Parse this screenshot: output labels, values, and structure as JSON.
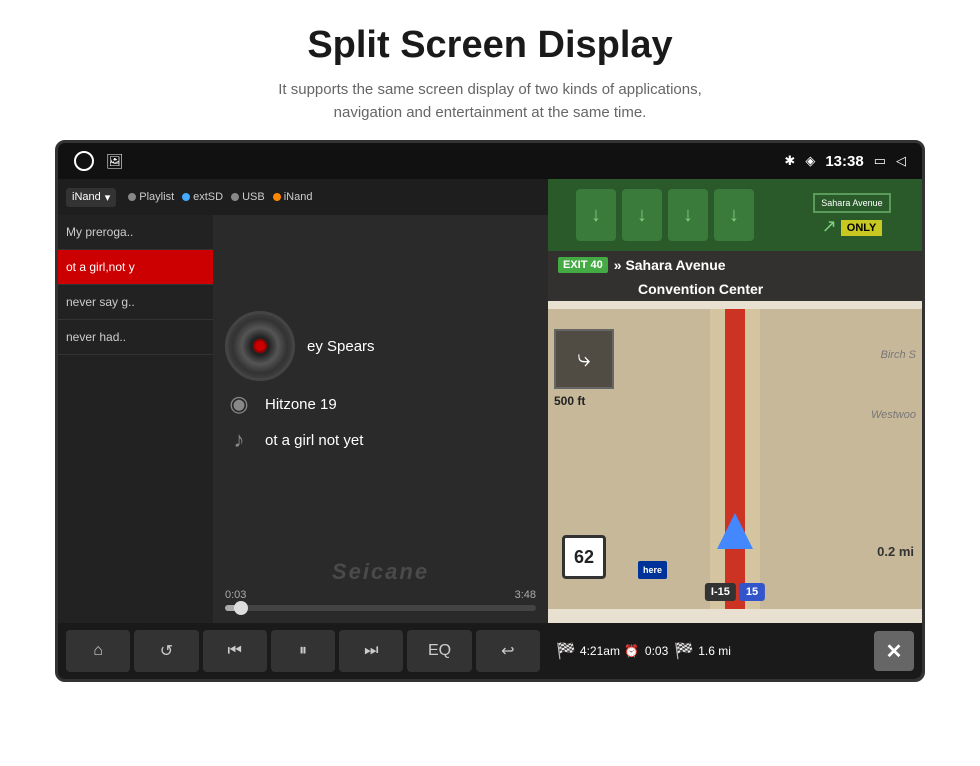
{
  "header": {
    "title": "Split Screen Display",
    "subtitle_line1": "It supports the same screen display of two kinds of applications,",
    "subtitle_line2": "navigation and entertainment at the same time."
  },
  "status_bar": {
    "time": "13:38",
    "bluetooth_icon": "✱",
    "location_icon": "◈",
    "window_icon": "▭",
    "back_icon": "◁"
  },
  "music_player": {
    "source_label": "iNand",
    "source_options": [
      "Playlist",
      "extSD",
      "USB",
      "iNand"
    ],
    "playlist": [
      {
        "title": "My preroga..",
        "active": false
      },
      {
        "title": "ot a girl,not y",
        "active": true
      },
      {
        "title": "never say g..",
        "active": false
      },
      {
        "title": "never had..",
        "active": false
      }
    ],
    "artist": "ey Spears",
    "album": "Hitzone 19",
    "track": "ot a girl not yet",
    "time_current": "0:03",
    "time_total": "3:48",
    "watermark": "Seicane",
    "controls": [
      "⌂",
      "↺",
      "⏮",
      "⏸",
      "⏭",
      "EQ",
      "↩"
    ]
  },
  "navigation": {
    "street_name": "Sahara Avenue",
    "venue": "Convention Center",
    "exit_number": "EXIT 40",
    "direction_label": "»",
    "only_label": "ONLY",
    "speed_limit": "62",
    "highway_name": "I-15",
    "highway_number": "15",
    "distance_turn": "0.2 mi",
    "distance_500ft": "500 ft",
    "bottom_eta": "4:21am",
    "bottom_time": "0:03",
    "bottom_distance": "1.6 mi",
    "here_label": "here"
  }
}
